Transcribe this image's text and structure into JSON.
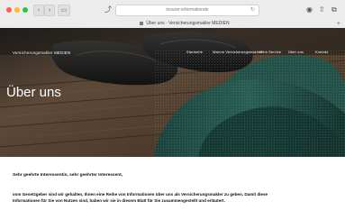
{
  "browser": {
    "url": "insurer-informationde",
    "tab_label": "Über uns - Versicherungsmakler MEDIEN",
    "colors": {
      "chrome_bg": "#ececec",
      "close": "#fc5f57",
      "minimize": "#fdbc2e",
      "zoom": "#28c840"
    }
  },
  "site": {
    "logo_text": "Versicherungsmakler MEDIEN",
    "nav": [
      "Startseite",
      "Warum Versicherungsmakler?",
      "Mein Service",
      "Über uns",
      "Kontakt"
    ],
    "hero_title": "Über uns"
  },
  "content": {
    "greeting": "Sehr geehrte Interessentin, sehr geehrter Interessent,",
    "paragraph": "vom Gesetzgeber sind wir gehalten, Ihnen eine Reihe von Informationen über uns als Versicherungsmakler zu geben. Damit diese Informationen für Sie von Nutzen sind, haben wir sie in diesem Blatt für Sie zusammengestellt und erläutert."
  }
}
